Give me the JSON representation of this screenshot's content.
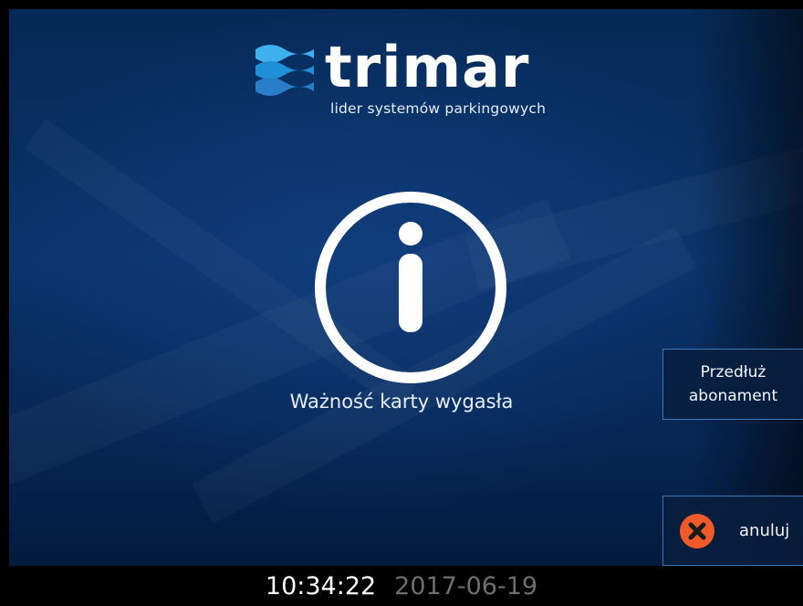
{
  "brand": {
    "name": "trimar",
    "tagline": "lider systemów parkingowych",
    "wave_colors": [
      "#1f8fd8",
      "#3fb0ee",
      "#2a7ec9"
    ]
  },
  "status": {
    "icon": "info-icon",
    "message": "Ważność karty wygasła"
  },
  "actions": {
    "extend_label_line1": "Przedłuż",
    "extend_label_line2": "abonament",
    "cancel_icon": "close-circle-icon",
    "cancel_label": "anuluj",
    "cancel_color": "#f05a28"
  },
  "footer": {
    "time": "10:34:22",
    "date": "2017-06-19"
  }
}
